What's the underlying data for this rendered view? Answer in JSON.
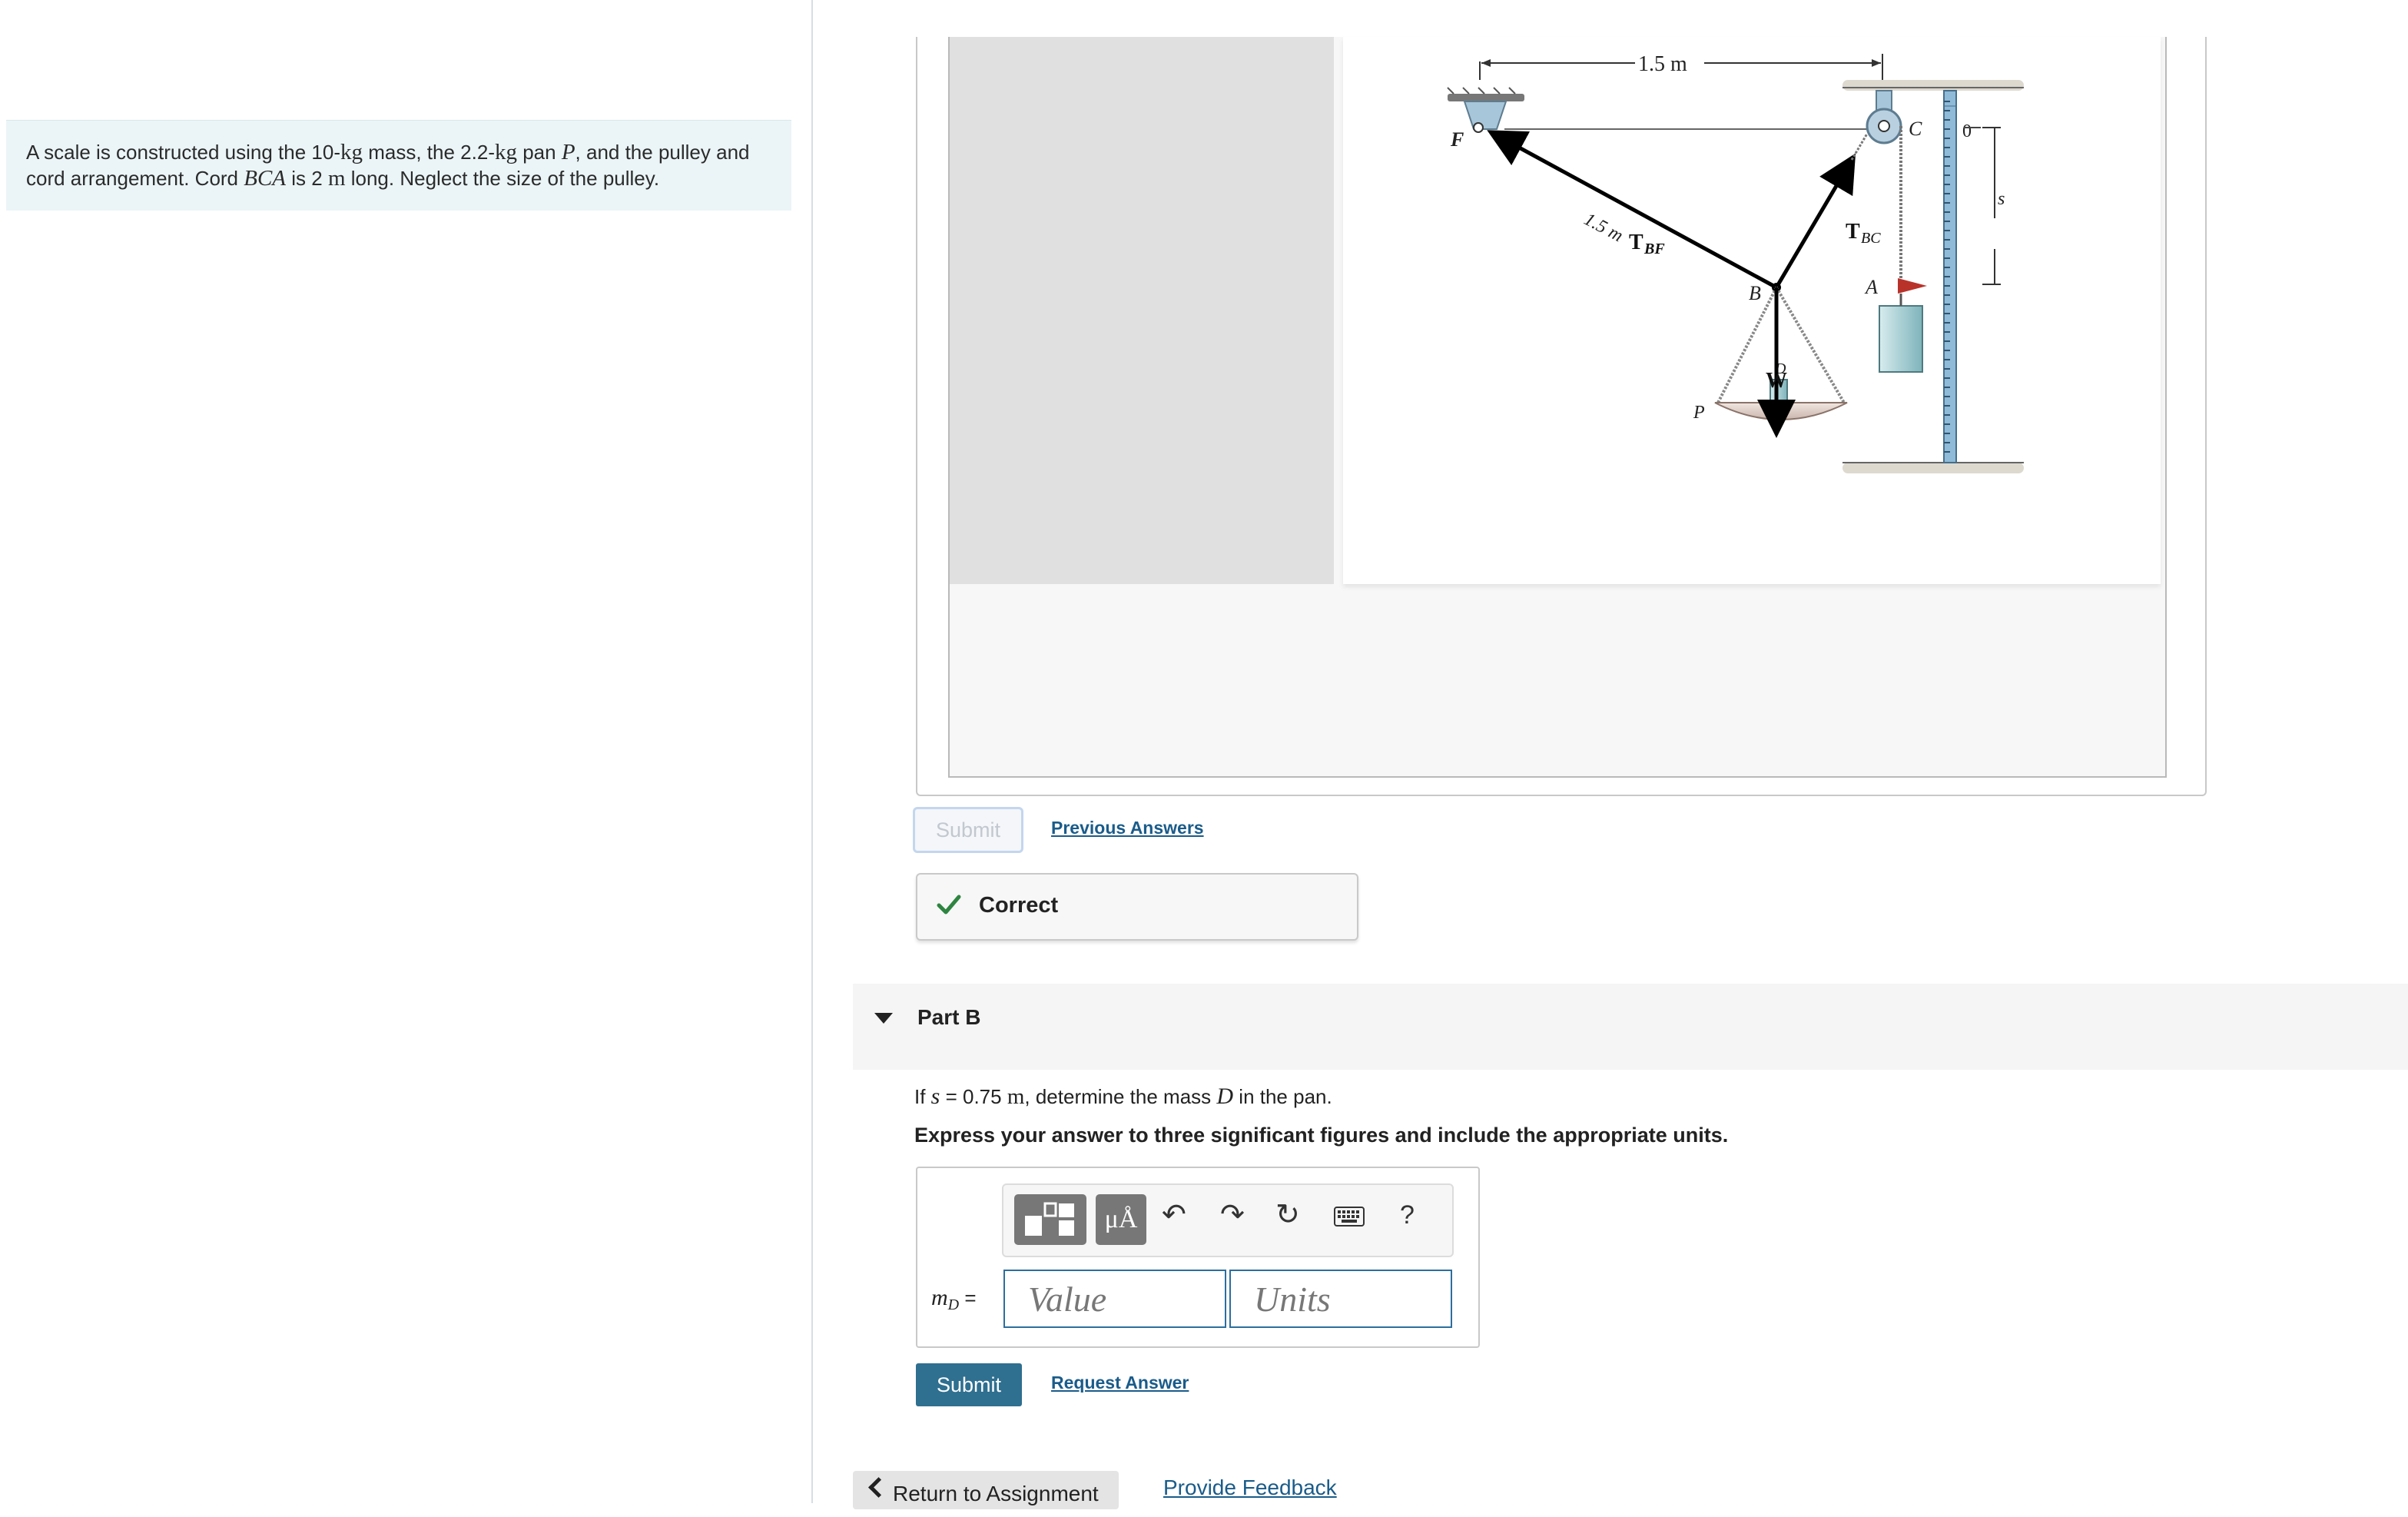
{
  "intro": {
    "p1": "A scale is constructed using the 10-",
    "kg1": "kg",
    "p2": " mass, the 2.2-",
    "kg2": "kg",
    "p3": " pan ",
    "P": "P",
    "p4": ", and the pulley and cord arrangement. Cord ",
    "BCA": "BCA",
    "p5": " is 2 ",
    "m": "m",
    "p6": " long. Neglect the size of the pulley."
  },
  "figure": {
    "dim_top": "1.5 m",
    "dim_bf": "1.5 m",
    "label_F": "F",
    "label_C": "C",
    "label_B": "B",
    "label_A": "A",
    "label_P": "P",
    "label_D": "D",
    "label_W": "W",
    "T_BC": "T",
    "T_BC_sub": "BC",
    "T_BF": "T",
    "T_BF_sub": "BF",
    "scale_zero": "0",
    "label_s": "s"
  },
  "part_a": {
    "submit_label": "Submit",
    "previous_answers": "Previous Answers",
    "status": "Correct"
  },
  "part_b": {
    "title": "Part B",
    "q1": "If ",
    "q_s": "s",
    "q2": " = 0.75 ",
    "q_m": "m",
    "q3": ", determine the mass ",
    "q_D": "D",
    "q4": " in the pan.",
    "instruction": "Express your answer to three significant figures and include the appropriate units.",
    "toolbar": {
      "symbols": "μÅ",
      "undo": "↶",
      "redo": "↷",
      "reset": "↻",
      "help": "?"
    },
    "var_m": "m",
    "var_sub": "D",
    "var_eq": " =",
    "value_placeholder": "Value",
    "units_placeholder": "Units",
    "submit_label": "Submit",
    "request_answer": "Request Answer"
  },
  "footer": {
    "return": "Return to Assignment",
    "feedback": "Provide Feedback"
  }
}
